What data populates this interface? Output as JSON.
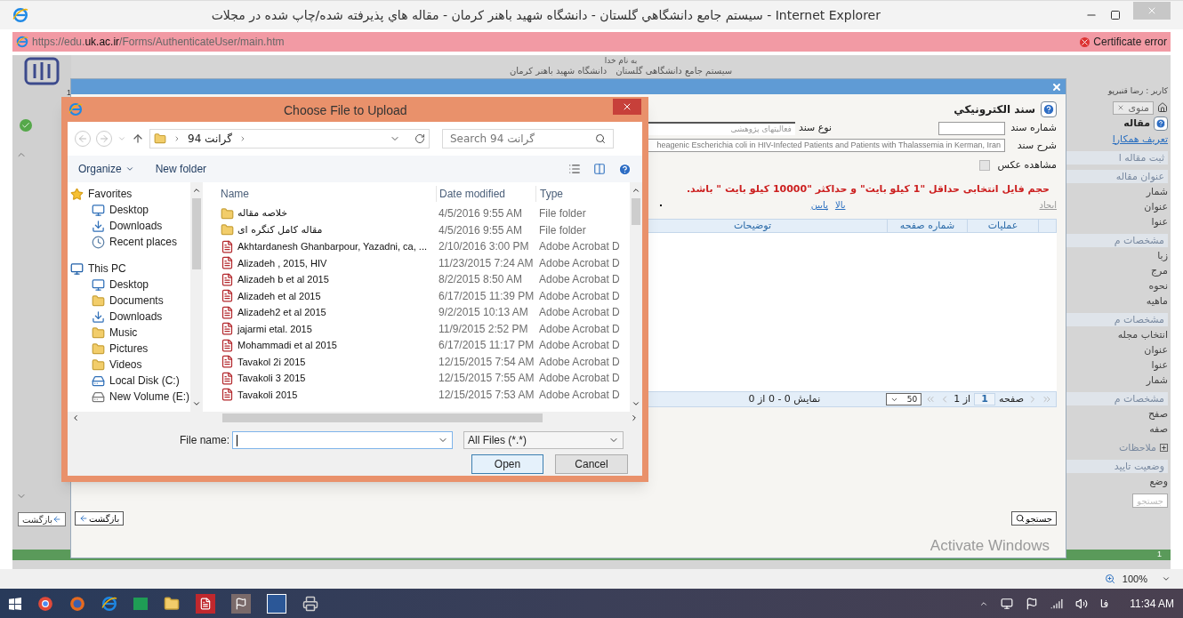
{
  "browser": {
    "title": "Internet Explorer - سیستم جامع دانشگاهي گلستان - دانشگاه شهيد باهنر کرمان - مقاله هاي پذيرفته شده/چاپ شده در مجلات",
    "address_prefix": "https://edu.",
    "address_domain": "uk.ac.ir",
    "address_path": "/Forms/AuthenticateUser/main.htm",
    "certificate_error": "Certificate error",
    "zoom": "100%"
  },
  "page": {
    "header_line_1": "به نام خدا",
    "header_system": "سیستم جامع دانشگاهی گلستان",
    "header_university": "دانشگاه شهید باهنر کرمان",
    "page_number": "1",
    "user": "کاربر : رضا قنبرپو",
    "menu_tab": "منوی",
    "back_button": "بازگشت",
    "status_number": "1",
    "activate_text": "Activate Windows",
    "right_panel": [
      {
        "kind": "title",
        "text": "مقاله"
      },
      {
        "kind": "link",
        "text": "تعریف همکارا"
      },
      {
        "kind": "section",
        "text": "ثبت مقاله ا"
      },
      {
        "kind": "section",
        "text": "عنوان مقاله"
      },
      {
        "kind": "label",
        "text": "شمار"
      },
      {
        "kind": "label",
        "text": "عنوان"
      },
      {
        "kind": "label",
        "text": "عنوا"
      },
      {
        "kind": "section",
        "text": "مشخصات م"
      },
      {
        "kind": "label",
        "text": "زبا"
      },
      {
        "kind": "label",
        "text": "مرج"
      },
      {
        "kind": "label",
        "text": "نحوه"
      },
      {
        "kind": "label",
        "text": "ماهیه"
      },
      {
        "kind": "section",
        "text": "مشخصات م"
      },
      {
        "kind": "label",
        "text": "انتخاب مجله"
      },
      {
        "kind": "label",
        "text": "عنوان"
      },
      {
        "kind": "label",
        "text": "عنوا"
      },
      {
        "kind": "label",
        "text": "شمار"
      },
      {
        "kind": "section",
        "text": "مشخصات م"
      },
      {
        "kind": "label",
        "text": "صفح"
      },
      {
        "kind": "label",
        "text": "صفه"
      },
      {
        "kind": "expandable",
        "text": "ملاحظات"
      },
      {
        "kind": "section",
        "text": "وضعیت تایید"
      },
      {
        "kind": "label",
        "text": "وضع"
      },
      {
        "kind": "search",
        "text": "جستجو"
      }
    ]
  },
  "modal": {
    "title": "سند الكترونيكي",
    "doc_number_label": "شماره سند",
    "doc_type_label": "نوع سند",
    "doc_type_value": "فعالیتهای پژوهشی",
    "description_label": "شرح سند",
    "description_value": "heagenic Escherichia coli in HIV-Infected Patients and Patients with Thalassemia in Kerman, Iran",
    "show_photo_label": "مشاهده عکس",
    "show_photo_checked": false,
    "message": "حجم فایل انتخابی حداقل \"1 کیلو بایت\" و حداکثر \"10000 کیلو بایت \" باشد.",
    "create_link": "ایجاد",
    "up_link": "بالا",
    "down_link": "پایین",
    "columns": [
      "عملیات",
      "شماره صفحه",
      "توضیحات"
    ],
    "page_label": "صفحه",
    "page_value": "1",
    "page_of": "از 1",
    "page_size": "50",
    "showing": "نمایش 0 - 0 از 0",
    "back_button": "بازگشت",
    "search_button": "جستجو"
  },
  "file_dialog": {
    "title": "Choose File to Upload",
    "breadcrumb": "گرانت 94",
    "search_placeholder": "Search گرانت 94",
    "organize": "Organize",
    "new_folder": "New folder",
    "nav": [
      {
        "label": "Favorites",
        "kind": "favorites",
        "children": [
          {
            "label": "Desktop",
            "kind": "desktop"
          },
          {
            "label": "Downloads",
            "kind": "downloads"
          },
          {
            "label": "Recent places",
            "kind": "recent"
          }
        ]
      },
      {
        "label": "This PC",
        "kind": "pc",
        "children": [
          {
            "label": "Desktop",
            "kind": "desktop"
          },
          {
            "label": "Documents",
            "kind": "folder"
          },
          {
            "label": "Downloads",
            "kind": "downloads"
          },
          {
            "label": "Music",
            "kind": "folder"
          },
          {
            "label": "Pictures",
            "kind": "folder"
          },
          {
            "label": "Videos",
            "kind": "folder"
          },
          {
            "label": "Local Disk (C:)",
            "kind": "disk"
          },
          {
            "label": "New Volume (E:)",
            "kind": "drive"
          }
        ]
      }
    ],
    "name_header": "Name",
    "date_header": "Date modified",
    "type_header": "Type",
    "files": [
      {
        "name": "خلاصه مقاله",
        "date": "4/5/2016 9:55 AM",
        "type": "File folder",
        "kind": "folder"
      },
      {
        "name": "مقاله کامل کنگره ای",
        "date": "4/5/2016 9:55 AM",
        "type": "File folder",
        "kind": "folder"
      },
      {
        "name": "Akhtardanesh Ghanbarpour, Yazadni, ca, ...",
        "date": "2/10/2016 3:00 PM",
        "type": "Adobe Acrobat D",
        "kind": "pdf"
      },
      {
        "name": "Alizadeh , 2015, HIV",
        "date": "11/23/2015 7:24 AM",
        "type": "Adobe Acrobat D",
        "kind": "pdf"
      },
      {
        "name": "Alizadeh b et al 2015",
        "date": "8/2/2015 8:50 AM",
        "type": "Adobe Acrobat D",
        "kind": "pdf"
      },
      {
        "name": "Alizadeh et al 2015",
        "date": "6/17/2015 11:39 PM",
        "type": "Adobe Acrobat D",
        "kind": "pdf"
      },
      {
        "name": "Alizadeh2 et al 2015",
        "date": "9/2/2015 10:13 AM",
        "type": "Adobe Acrobat D",
        "kind": "pdf"
      },
      {
        "name": "jajarmi etal. 2015",
        "date": "11/9/2015 2:52 PM",
        "type": "Adobe Acrobat D",
        "kind": "pdf"
      },
      {
        "name": "Mohammadi et al 2015",
        "date": "6/17/2015 11:17 PM",
        "type": "Adobe Acrobat D",
        "kind": "pdf"
      },
      {
        "name": "Tavakol 2i 2015",
        "date": "12/15/2015 7:54 AM",
        "type": "Adobe Acrobat D",
        "kind": "pdf"
      },
      {
        "name": "Tavakoli 3 2015",
        "date": "12/15/2015 7:55 AM",
        "type": "Adobe Acrobat D",
        "kind": "pdf"
      },
      {
        "name": "Tavakoli 2015",
        "date": "12/15/2015 7:53 AM",
        "type": "Adobe Acrobat D",
        "kind": "pdf"
      }
    ],
    "file_name_label": "File name:",
    "filter": "All Files (*.*)",
    "open_button": "Open",
    "cancel_button": "Cancel"
  },
  "taskbar": {
    "language": "فا",
    "time": "11:34 AM"
  }
}
